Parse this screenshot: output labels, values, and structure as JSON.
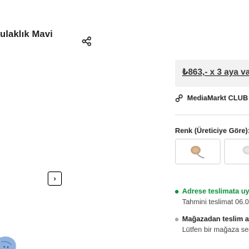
{
  "product": {
    "title": "ulaklık Mavi"
  },
  "purchase": {
    "installment_price": "₺863,- x 3 aya va",
    "club_text": "MediaMarkt CLUB ü"
  },
  "variants": {
    "color_label": "Renk (Üreticiye Göre): "
  },
  "delivery": {
    "home_title": "Adrese teslimata uyg",
    "home_subtitle": "Tahmini teslimat 06.0",
    "store_title": "Mağazadan teslim al",
    "store_subtitle": "Lütfen bir mağaza seç"
  },
  "gallery": {
    "next_label": "›"
  },
  "colors": {
    "accent_green": "#0a8f3c",
    "price_box_bg": "#f2f2f2",
    "product_blue": "#8fb2e0"
  },
  "icons": {
    "share": "share-icon",
    "club": "club-icon",
    "next": "chevron-right-icon"
  }
}
